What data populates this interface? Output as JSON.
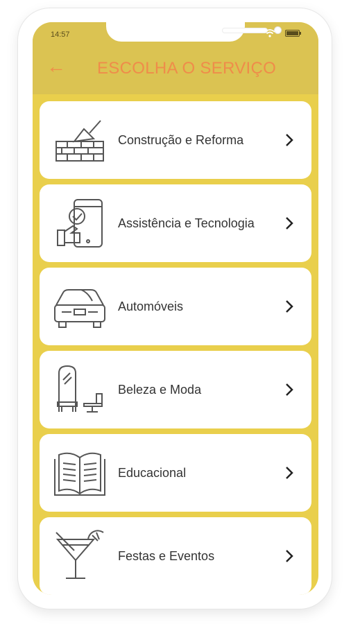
{
  "status_bar": {
    "time": "14:57"
  },
  "header": {
    "title": "ESCOLHA O SERVIÇO",
    "back_icon": "arrow-left-icon"
  },
  "colors": {
    "header_bg": "#dbc352",
    "screen_bg": "#e9cf4c",
    "title": "#ef8c4a",
    "card_bg": "#ffffff"
  },
  "services": [
    {
      "label": "Construção e Reforma",
      "icon": "brick-wall-trowel-icon"
    },
    {
      "label": "Assistência e Tecnologia",
      "icon": "smartphone-repair-icon"
    },
    {
      "label": "Automóveis",
      "icon": "car-icon"
    },
    {
      "label": "Beleza e Moda",
      "icon": "salon-mirror-chair-icon"
    },
    {
      "label": "Educacional",
      "icon": "open-book-icon"
    },
    {
      "label": "Festas e Eventos",
      "icon": "cocktail-glass-icon"
    }
  ]
}
